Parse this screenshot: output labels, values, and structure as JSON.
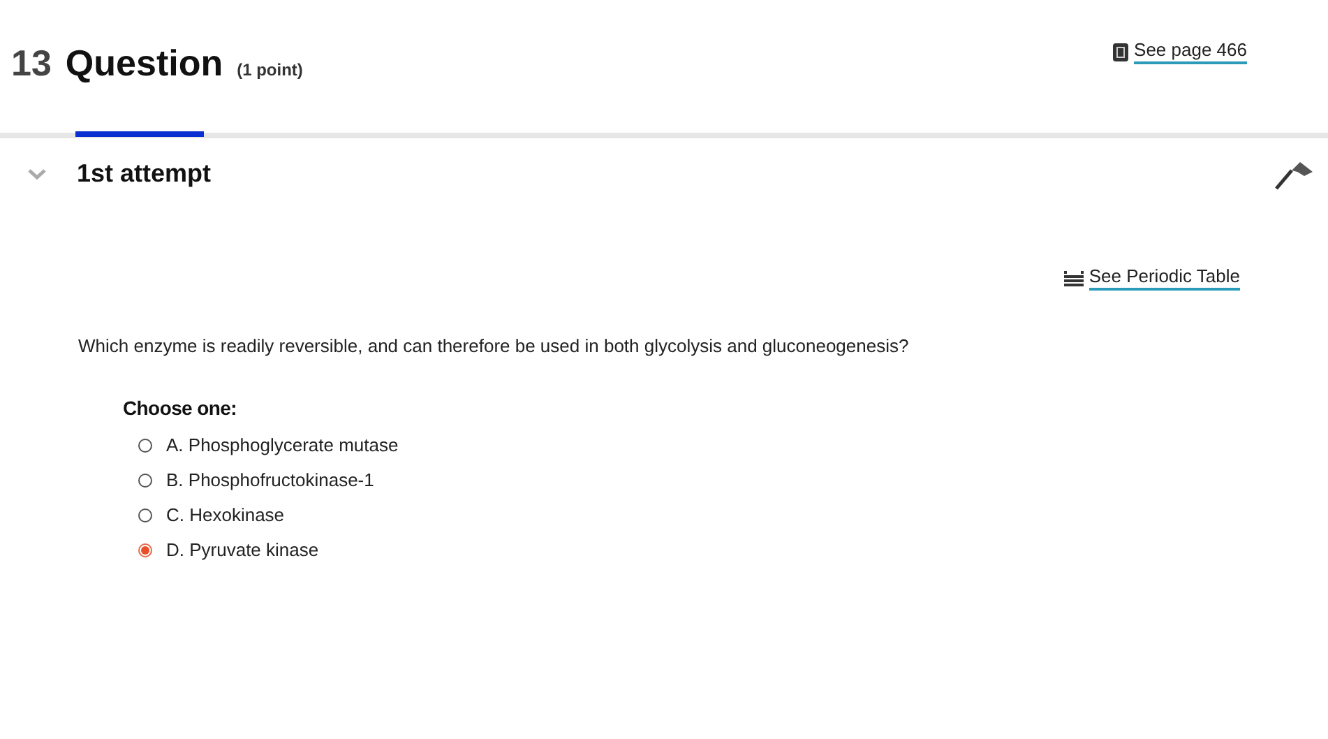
{
  "question": {
    "number": "13",
    "title": "Question",
    "points": "(1 point)"
  },
  "page_link": "See page 466",
  "attempt_tab": {
    "label": "1st attempt",
    "selected": true
  },
  "periodic_link": "See Periodic Table",
  "prompt": "Which enzyme is readily reversible, and can therefore be used in both glycolysis and gluconeogenesis?",
  "choose_label": "Choose one:",
  "options": [
    {
      "letter": "A.",
      "text": "Phosphoglycerate mutase",
      "selected": false
    },
    {
      "letter": "B.",
      "text": "Phosphofructokinase-1",
      "selected": false
    },
    {
      "letter": "C.",
      "text": "Hexokinase",
      "selected": false
    },
    {
      "letter": "D.",
      "text": "Pyruvate kinase",
      "selected": true
    }
  ]
}
